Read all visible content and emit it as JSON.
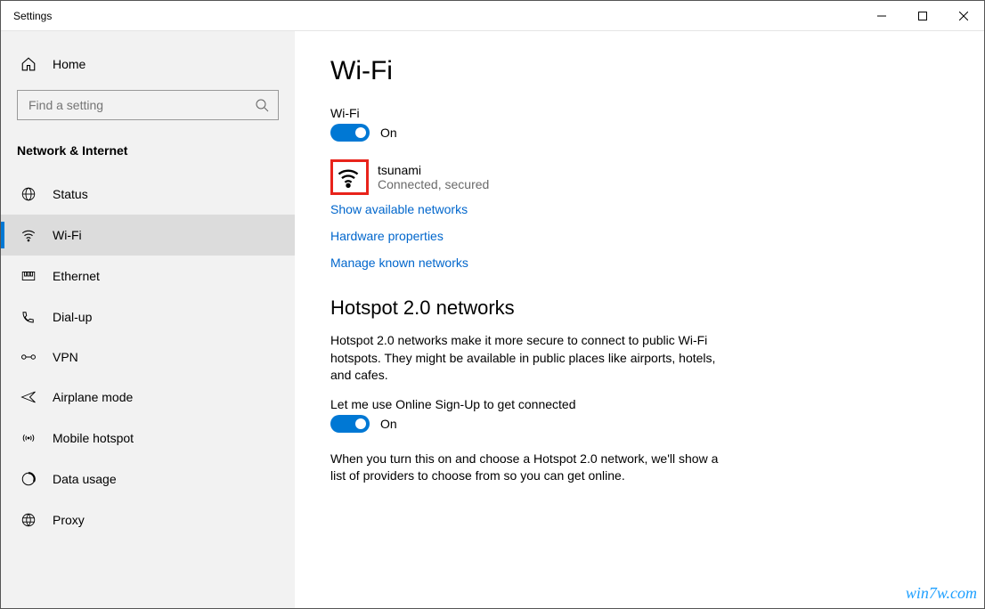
{
  "window": {
    "title": "Settings"
  },
  "sidebar": {
    "home_label": "Home",
    "search_placeholder": "Find a setting",
    "category": "Network & Internet",
    "items": [
      {
        "label": "Status"
      },
      {
        "label": "Wi-Fi"
      },
      {
        "label": "Ethernet"
      },
      {
        "label": "Dial-up"
      },
      {
        "label": "VPN"
      },
      {
        "label": "Airplane mode"
      },
      {
        "label": "Mobile hotspot"
      },
      {
        "label": "Data usage"
      },
      {
        "label": "Proxy"
      }
    ]
  },
  "main": {
    "title": "Wi-Fi",
    "wifi_label": "Wi-Fi",
    "wifi_toggle_state": "On",
    "network": {
      "name": "tsunami",
      "status": "Connected, secured"
    },
    "links": {
      "show_networks": "Show available networks",
      "hardware_props": "Hardware properties",
      "manage_known": "Manage known networks"
    },
    "hotspot": {
      "heading": "Hotspot 2.0 networks",
      "description": "Hotspot 2.0 networks make it more secure to connect to public Wi-Fi hotspots. They might be available in public places like airports, hotels, and cafes.",
      "signup_label": "Let me use Online Sign-Up to get connected",
      "signup_state": "On",
      "footer": "When you turn this on and choose a Hotspot 2.0 network, we'll show a list of providers to choose from so you can get online."
    }
  },
  "watermark": "win7w.com",
  "colors": {
    "accent": "#0078d4",
    "link": "#0066cc",
    "highlight_border": "#e8231b"
  }
}
